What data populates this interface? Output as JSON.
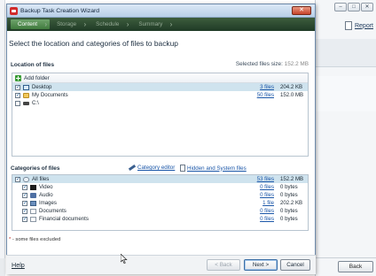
{
  "background_app": {
    "report_label": "Report",
    "back_label": "Back",
    "help_label": "Help"
  },
  "wizard": {
    "title": "Backup Task Creation Wizard",
    "close_label": "✕",
    "steps": [
      {
        "label": "Content",
        "active": true
      },
      {
        "label": "Storage",
        "active": false
      },
      {
        "label": "Schedule",
        "active": false
      },
      {
        "label": "Summary",
        "active": false
      }
    ],
    "heading": "Select the location and categories of files to backup",
    "location_title": "Location of files",
    "selected_size_label": "Selected files size:",
    "selected_size_value": "152.2 MB",
    "add_folder_label": "Add folder",
    "locations": [
      {
        "name": "Desktop",
        "files": "3 files",
        "size": "204.2 KB",
        "checked": true,
        "icon": "desktop-icon"
      },
      {
        "name": "My Documents",
        "files": "50 files",
        "size": "152.0 MB",
        "checked": true,
        "icon": "folder-icon"
      },
      {
        "name": "C:\\",
        "files": "",
        "size": "",
        "checked": false,
        "icon": "drive-icon"
      }
    ],
    "categories_title": "Categories of files",
    "category_editor_label": "Category editor",
    "hidden_system_label": "Hidden and System files",
    "categories": [
      {
        "name": "All files",
        "files": "53 files",
        "size": "152.2 MB",
        "checked": true,
        "icon": "all-files-icon"
      },
      {
        "name": "Video",
        "files": "0 files",
        "size": "0 bytes",
        "checked": true,
        "icon": "video-icon"
      },
      {
        "name": "Audio",
        "files": "0 files",
        "size": "0 bytes",
        "checked": true,
        "icon": "audio-icon"
      },
      {
        "name": "Images",
        "files": "1 file",
        "size": "202.2 KB",
        "checked": true,
        "icon": "images-icon"
      },
      {
        "name": "Documents",
        "files": "0 files",
        "size": "0 bytes",
        "checked": true,
        "icon": "documents-icon"
      },
      {
        "name": "Financial documents",
        "files": "0 files",
        "size": "0 bytes",
        "checked": true,
        "icon": "financial-icon"
      }
    ],
    "footnote_star": "*",
    "footnote_text": " - some files excluded",
    "help_label": "Help",
    "back_button": "< Back",
    "next_button": "Next >",
    "cancel_button": "Cancel"
  }
}
